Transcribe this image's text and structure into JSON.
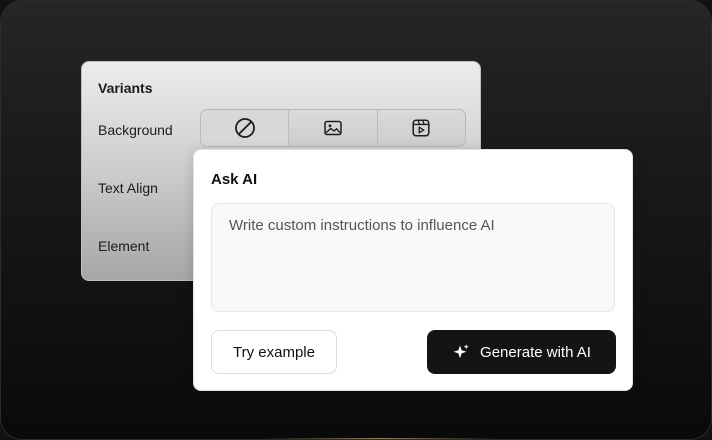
{
  "variants": {
    "title": "Variants",
    "rows": {
      "background": "Background",
      "text_align": "Text Align",
      "element": "Element"
    },
    "background_options": [
      {
        "icon": "none-icon",
        "selected": true
      },
      {
        "icon": "image-icon",
        "selected": false
      },
      {
        "icon": "video-icon",
        "selected": false
      }
    ]
  },
  "ask_ai": {
    "title": "Ask AI",
    "prompt_value": "",
    "prompt_placeholder": "Write custom instructions to influence AI",
    "try_example_label": "Try example",
    "generate_label": "Generate with AI",
    "generate_icon": "sparkle-icon"
  },
  "colors": {
    "primary_button_bg": "#141414",
    "accent_glow": "#c9a65b"
  }
}
